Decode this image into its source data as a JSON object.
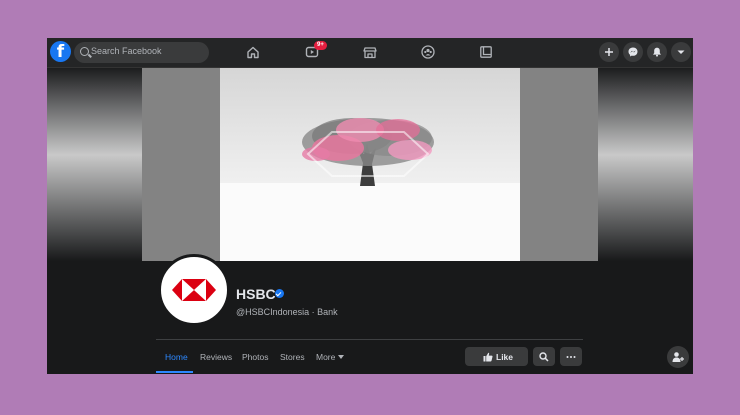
{
  "topbar": {
    "search_placeholder": "Search Facebook",
    "logo_letter": "f",
    "notification_badge": "9+",
    "nav_icons": [
      "home-icon",
      "watch-icon",
      "marketplace-icon",
      "groups-icon",
      "gaming-icon"
    ],
    "right_buttons": [
      "plus-icon",
      "messenger-icon",
      "bell-icon",
      "caret-down-icon"
    ]
  },
  "profile": {
    "name": "HSBC",
    "handle_category": "@HSBCIndonesia · Bank",
    "verified": true,
    "logo_colors": {
      "red": "#db0011",
      "white": "#ffffff"
    }
  },
  "tabs": [
    {
      "label": "Home",
      "active": true
    },
    {
      "label": "Reviews",
      "active": false
    },
    {
      "label": "Photos",
      "active": false
    },
    {
      "label": "Stores",
      "active": false
    },
    {
      "label": "More",
      "active": false
    }
  ],
  "actions": {
    "like_label": "Like"
  },
  "colors": {
    "accent": "#2d88ff",
    "facebook_blue": "#1877f2",
    "background": "#18191a",
    "surface": "#3a3b3c",
    "outer": "#b07cb6"
  }
}
